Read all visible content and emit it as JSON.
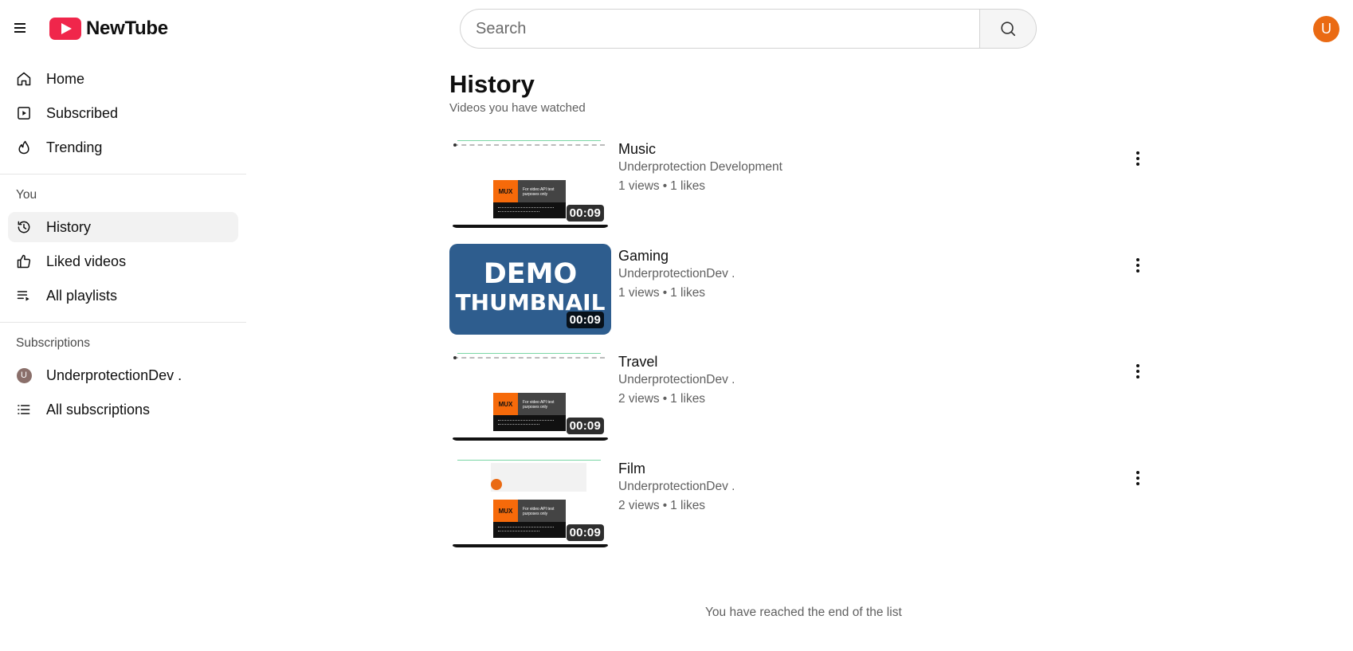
{
  "header": {
    "brand": "NewTube",
    "search_placeholder": "Search",
    "user_initial": "U"
  },
  "sidebar": {
    "main_items": [
      {
        "label": "Home",
        "icon": "home-icon"
      },
      {
        "label": "Subscribed",
        "icon": "subscriptions-icon"
      },
      {
        "label": "Trending",
        "icon": "flame-icon"
      }
    ],
    "you_title": "You",
    "you_items": [
      {
        "label": "History",
        "icon": "history-icon",
        "active": true
      },
      {
        "label": "Liked videos",
        "icon": "thumbs-up-icon"
      },
      {
        "label": "All playlists",
        "icon": "playlist-icon"
      }
    ],
    "subs_title": "Subscriptions",
    "subs_items": [
      {
        "label": "UnderprotectionDev .",
        "initial": "U"
      },
      {
        "label": "All subscriptions",
        "icon": "list-icon"
      }
    ]
  },
  "main": {
    "title": "History",
    "subtitle": "Videos you have watched",
    "videos": [
      {
        "title": "Music",
        "channel": "Underprotection Development",
        "views": "1 views",
        "likes": "1 likes",
        "duration": "00:09",
        "thumb": "mux"
      },
      {
        "title": "Gaming",
        "channel": "UnderprotectionDev .",
        "views": "1 views",
        "likes": "1 likes",
        "duration": "00:09",
        "thumb": "demo",
        "thumb_line1": "DEMO",
        "thumb_line2": "THUMBNAIL"
      },
      {
        "title": "Travel",
        "channel": "UnderprotectionDev .",
        "views": "2 views",
        "likes": "1 likes",
        "duration": "00:09",
        "thumb": "mux"
      },
      {
        "title": "Film",
        "channel": "UnderprotectionDev .",
        "views": "2 views",
        "likes": "1 likes",
        "duration": "00:09",
        "thumb": "film"
      }
    ],
    "thumb_mux_label": "MUX",
    "thumb_mux_caption": "For video API test purposes only",
    "separator": "•",
    "end_text": "You have reached the end of the list"
  },
  "colors": {
    "brand_red": "#f0264b",
    "avatar_orange": "#ea6a13",
    "active_bg": "#f2f2f2",
    "demo_blue": "#2e5d8e"
  }
}
